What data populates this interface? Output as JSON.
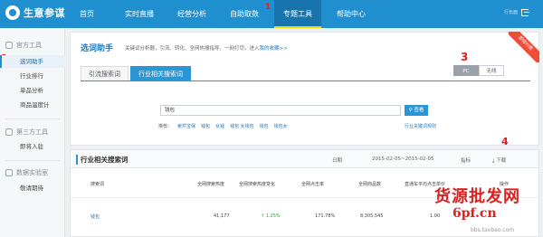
{
  "app": {
    "logo_text": "生意参谋"
  },
  "nav": {
    "items": [
      {
        "label": "首页"
      },
      {
        "label": "实时直播"
      },
      {
        "label": "经营分析"
      },
      {
        "label": "自助取数"
      },
      {
        "label": "专题工具",
        "active": true
      },
      {
        "label": "帮助中心"
      }
    ],
    "marker_1": "1",
    "user": "行长面"
  },
  "sidebar": {
    "sections": [
      {
        "title": "官方工具",
        "items": [
          "选词助手",
          "行业排行",
          "单品分析",
          "商品温度计"
        ]
      },
      {
        "title": "第三方工具",
        "items": [
          "即将入驻"
        ]
      },
      {
        "title": "数据实验室",
        "items": [
          "敬请期待"
        ]
      }
    ],
    "marker_2": "2"
  },
  "main": {
    "title": "选词助手",
    "description": "关键词分析器，引流、转化、全网热搜指导，一网打尽。进入",
    "description_link": "我的收藏>>",
    "tabs": [
      "引流搜索词",
      "行业相关搜索词"
    ],
    "marker_3": "3",
    "device_toggle": [
      "PC",
      "无线"
    ],
    "corner_badge": "即将付费",
    "search_value": "钱包",
    "search_button": "查看",
    "suggest_label": "推荐：",
    "suggest_items": [
      "索芹宝保",
      "钱包",
      "女钱",
      "钱包 女钱包",
      "钱包",
      "钱包女"
    ],
    "keyword_rules": "行业关键词规则"
  },
  "related": {
    "title": "行业相关搜索词",
    "period_label": "日期",
    "date_range": "2015-02-05~2015-02-05",
    "metric_label": "指标",
    "marker_4": "4",
    "download": "下载",
    "columns": [
      "搜索词",
      "全网搜索热度",
      "全网搜索热度变化",
      "全网点击率",
      "全网商品数",
      "直通车平均点击单价",
      "操作"
    ],
    "rows": [
      {
        "term": "钱包",
        "heat": "41,177",
        "change": "1.25%",
        "ctr": "171.78%",
        "products": "8,305,545",
        "cpc": "1.00"
      }
    ]
  },
  "watermark": {
    "line1": "货源批发网",
    "line2": "6pf.cn",
    "url": "bbs.taobao.com"
  },
  "colors": {
    "nav_bg": "#1f8fd0",
    "accent": "#2a96d6",
    "marker": "#e02020",
    "badge": "#f04d38"
  }
}
